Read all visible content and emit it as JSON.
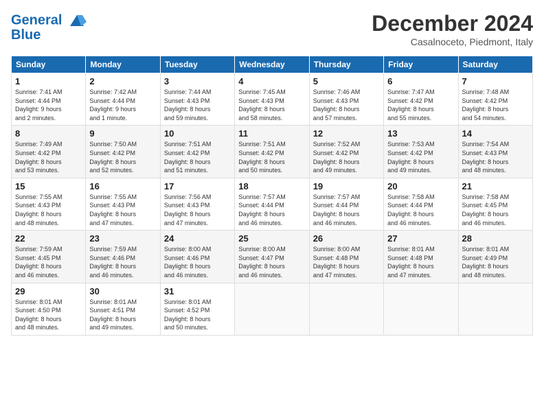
{
  "header": {
    "logo_line1": "General",
    "logo_line2": "Blue",
    "title": "December 2024",
    "subtitle": "Casalnoceto, Piedmont, Italy"
  },
  "days_of_week": [
    "Sunday",
    "Monday",
    "Tuesday",
    "Wednesday",
    "Thursday",
    "Friday",
    "Saturday"
  ],
  "weeks": [
    [
      {
        "day": "1",
        "info": "Sunrise: 7:41 AM\nSunset: 4:44 PM\nDaylight: 9 hours\nand 2 minutes."
      },
      {
        "day": "2",
        "info": "Sunrise: 7:42 AM\nSunset: 4:44 PM\nDaylight: 9 hours\nand 1 minute."
      },
      {
        "day": "3",
        "info": "Sunrise: 7:44 AM\nSunset: 4:43 PM\nDaylight: 8 hours\nand 59 minutes."
      },
      {
        "day": "4",
        "info": "Sunrise: 7:45 AM\nSunset: 4:43 PM\nDaylight: 8 hours\nand 58 minutes."
      },
      {
        "day": "5",
        "info": "Sunrise: 7:46 AM\nSunset: 4:43 PM\nDaylight: 8 hours\nand 57 minutes."
      },
      {
        "day": "6",
        "info": "Sunrise: 7:47 AM\nSunset: 4:42 PM\nDaylight: 8 hours\nand 55 minutes."
      },
      {
        "day": "7",
        "info": "Sunrise: 7:48 AM\nSunset: 4:42 PM\nDaylight: 8 hours\nand 54 minutes."
      }
    ],
    [
      {
        "day": "8",
        "info": "Sunrise: 7:49 AM\nSunset: 4:42 PM\nDaylight: 8 hours\nand 53 minutes."
      },
      {
        "day": "9",
        "info": "Sunrise: 7:50 AM\nSunset: 4:42 PM\nDaylight: 8 hours\nand 52 minutes."
      },
      {
        "day": "10",
        "info": "Sunrise: 7:51 AM\nSunset: 4:42 PM\nDaylight: 8 hours\nand 51 minutes."
      },
      {
        "day": "11",
        "info": "Sunrise: 7:51 AM\nSunset: 4:42 PM\nDaylight: 8 hours\nand 50 minutes."
      },
      {
        "day": "12",
        "info": "Sunrise: 7:52 AM\nSunset: 4:42 PM\nDaylight: 8 hours\nand 49 minutes."
      },
      {
        "day": "13",
        "info": "Sunrise: 7:53 AM\nSunset: 4:42 PM\nDaylight: 8 hours\nand 49 minutes."
      },
      {
        "day": "14",
        "info": "Sunrise: 7:54 AM\nSunset: 4:43 PM\nDaylight: 8 hours\nand 48 minutes."
      }
    ],
    [
      {
        "day": "15",
        "info": "Sunrise: 7:55 AM\nSunset: 4:43 PM\nDaylight: 8 hours\nand 48 minutes."
      },
      {
        "day": "16",
        "info": "Sunrise: 7:55 AM\nSunset: 4:43 PM\nDaylight: 8 hours\nand 47 minutes."
      },
      {
        "day": "17",
        "info": "Sunrise: 7:56 AM\nSunset: 4:43 PM\nDaylight: 8 hours\nand 47 minutes."
      },
      {
        "day": "18",
        "info": "Sunrise: 7:57 AM\nSunset: 4:44 PM\nDaylight: 8 hours\nand 46 minutes."
      },
      {
        "day": "19",
        "info": "Sunrise: 7:57 AM\nSunset: 4:44 PM\nDaylight: 8 hours\nand 46 minutes."
      },
      {
        "day": "20",
        "info": "Sunrise: 7:58 AM\nSunset: 4:44 PM\nDaylight: 8 hours\nand 46 minutes."
      },
      {
        "day": "21",
        "info": "Sunrise: 7:58 AM\nSunset: 4:45 PM\nDaylight: 8 hours\nand 46 minutes."
      }
    ],
    [
      {
        "day": "22",
        "info": "Sunrise: 7:59 AM\nSunset: 4:45 PM\nDaylight: 8 hours\nand 46 minutes."
      },
      {
        "day": "23",
        "info": "Sunrise: 7:59 AM\nSunset: 4:46 PM\nDaylight: 8 hours\nand 46 minutes."
      },
      {
        "day": "24",
        "info": "Sunrise: 8:00 AM\nSunset: 4:46 PM\nDaylight: 8 hours\nand 46 minutes."
      },
      {
        "day": "25",
        "info": "Sunrise: 8:00 AM\nSunset: 4:47 PM\nDaylight: 8 hours\nand 46 minutes."
      },
      {
        "day": "26",
        "info": "Sunrise: 8:00 AM\nSunset: 4:48 PM\nDaylight: 8 hours\nand 47 minutes."
      },
      {
        "day": "27",
        "info": "Sunrise: 8:01 AM\nSunset: 4:48 PM\nDaylight: 8 hours\nand 47 minutes."
      },
      {
        "day": "28",
        "info": "Sunrise: 8:01 AM\nSunset: 4:49 PM\nDaylight: 8 hours\nand 48 minutes."
      }
    ],
    [
      {
        "day": "29",
        "info": "Sunrise: 8:01 AM\nSunset: 4:50 PM\nDaylight: 8 hours\nand 48 minutes."
      },
      {
        "day": "30",
        "info": "Sunrise: 8:01 AM\nSunset: 4:51 PM\nDaylight: 8 hours\nand 49 minutes."
      },
      {
        "day": "31",
        "info": "Sunrise: 8:01 AM\nSunset: 4:52 PM\nDaylight: 8 hours\nand 50 minutes."
      },
      {
        "day": "",
        "info": ""
      },
      {
        "day": "",
        "info": ""
      },
      {
        "day": "",
        "info": ""
      },
      {
        "day": "",
        "info": ""
      }
    ]
  ]
}
